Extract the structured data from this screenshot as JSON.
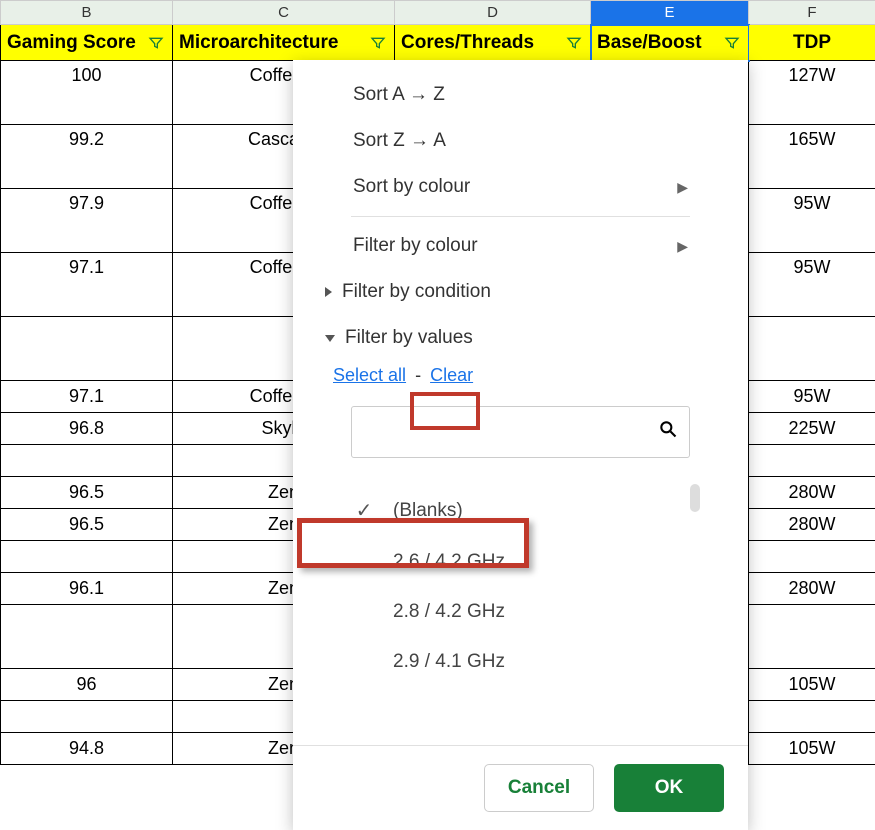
{
  "columns": {
    "B": {
      "letter": "B",
      "header": "Gaming Score"
    },
    "C": {
      "letter": "C",
      "header": "Microarchitecture"
    },
    "D": {
      "letter": "D",
      "header": "Cores/Threads"
    },
    "E": {
      "letter": "E",
      "header": "Base/Boost"
    },
    "F": {
      "letter": "F",
      "header": "TDP"
    }
  },
  "rows": [
    {
      "b": "100",
      "c": "Coffee L",
      "f": "127W",
      "tall": true
    },
    {
      "b": "99.2",
      "c": "Cascade",
      "f": "165W",
      "tall": true
    },
    {
      "b": "97.9",
      "c": "Coffee L",
      "f": "95W",
      "tall": true
    },
    {
      "b": "97.1",
      "c": "Coffee L",
      "f": "95W",
      "tall": true
    },
    {
      "b": "",
      "c": "",
      "f": "",
      "tall": true
    },
    {
      "b": "97.1",
      "c": "Coffee L",
      "f": "95W",
      "tall": false
    },
    {
      "b": "96.8",
      "c": "Skyla",
      "f": "225W",
      "tall": false
    },
    {
      "b": "",
      "c": "",
      "f": "",
      "tall": false
    },
    {
      "b": "96.5",
      "c": "Zen",
      "f": "280W",
      "tall": false
    },
    {
      "b": "96.5",
      "c": "Zen",
      "f": "280W",
      "tall": false
    },
    {
      "b": "",
      "c": "",
      "f": "",
      "tall": false
    },
    {
      "b": "96.1",
      "c": "Zen",
      "f": "280W",
      "tall": false
    },
    {
      "b": "",
      "c": "",
      "f": "",
      "tall": true
    },
    {
      "b": "96",
      "c": "Zen",
      "f": "105W",
      "tall": false
    },
    {
      "b": "",
      "c": "",
      "f": "",
      "tall": false
    },
    {
      "b": "94.8",
      "c": "Zen",
      "f": "105W",
      "tall": false
    }
  ],
  "panel": {
    "sort_az": "Sort A → Z",
    "sort_za": "Sort Z → A",
    "sort_colour": "Sort by colour",
    "filter_colour": "Filter by colour",
    "filter_condition": "Filter by condition",
    "filter_values": "Filter by values",
    "select_all": "Select all",
    "dash": "-",
    "clear": "Clear",
    "search_placeholder": "",
    "values": [
      {
        "label": "(Blanks)",
        "checked": true
      },
      {
        "label": "2.6 / 4.2 GHz",
        "checked": false
      },
      {
        "label": "2.8 / 4.2 GHz",
        "checked": false
      },
      {
        "label": "2.9 / 4.1 GHz",
        "checked": false
      }
    ],
    "cancel": "Cancel",
    "ok": "OK"
  }
}
